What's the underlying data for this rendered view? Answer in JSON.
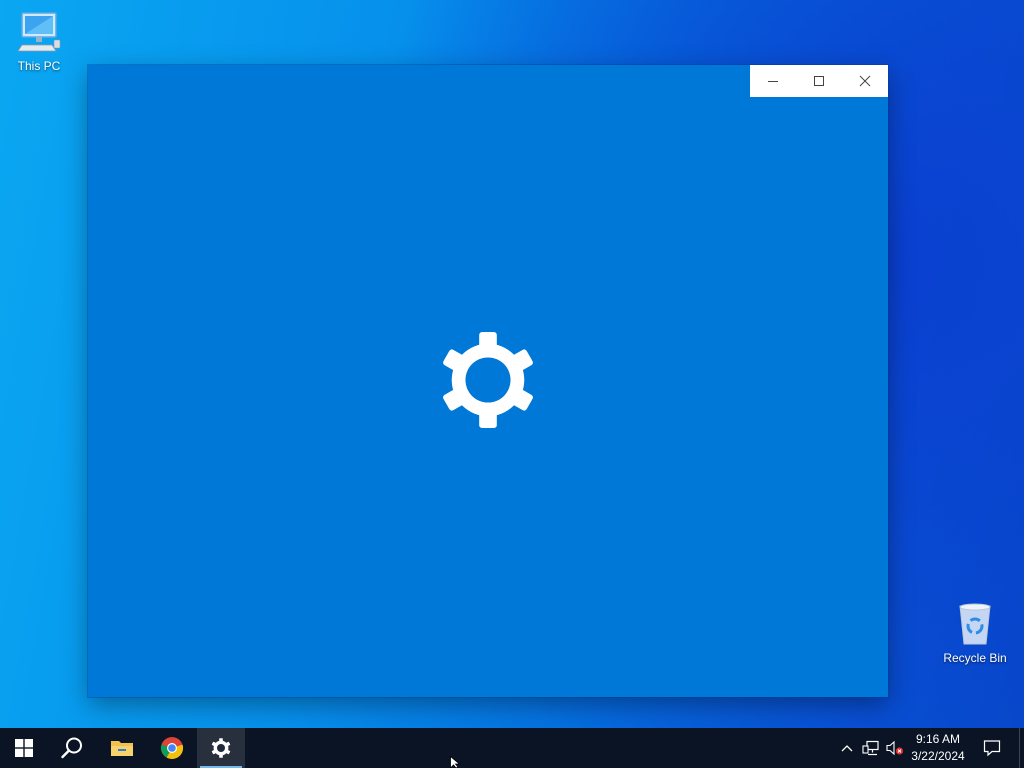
{
  "desktop": {
    "icons": [
      {
        "label": "This PC",
        "icon": "computer-icon"
      },
      {
        "label": "Recycle Bin",
        "icon": "recycle-bin-icon"
      }
    ]
  },
  "window": {
    "app": "Settings",
    "splash_icon": "gear-icon",
    "background": "#0078d7",
    "caption_buttons": {
      "minimize": "minimize-icon",
      "maximize": "maximize-icon",
      "close": "close-icon"
    }
  },
  "taskbar": {
    "items": [
      "start-icon",
      "search-icon",
      "file-explorer-icon",
      "chrome-icon",
      "settings-icon"
    ],
    "active_item": "settings-icon",
    "tray": {
      "chevron": "chevron-up-icon",
      "network": "network-icon",
      "volume": "volume-muted-icon"
    },
    "time": "9:16 AM",
    "date": "3/22/2024"
  }
}
